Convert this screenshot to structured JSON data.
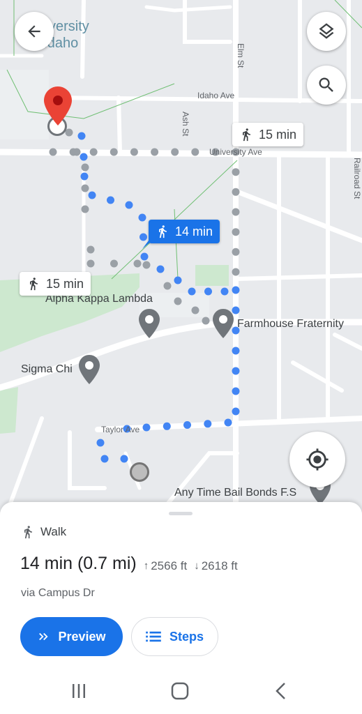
{
  "map": {
    "labels": {
      "university": "University\nof Idaho",
      "idaho_ave": "Idaho Ave",
      "ash_st": "Ash St",
      "elm_st": "Elm St",
      "university_ave": "University Ave",
      "railroad_st": "Railroad St",
      "taylor_ave": "Taylor Ave",
      "alpha_kappa_lambda": "Alpha Kappa Lambda",
      "farmhouse_fraternity": "Farmhouse Fraternity",
      "sigma_chi": "Sigma Chi",
      "bail_bonds": "Any Time Bail Bonds F.S"
    },
    "routes": [
      {
        "time": "15 min",
        "selected": false
      },
      {
        "time": "14 min",
        "selected": true
      },
      {
        "time": "15 min",
        "selected": false
      }
    ],
    "colors": {
      "route_active": "#4285f4",
      "route_alt": "#9aa0a6",
      "destination_pin": "#ea4335",
      "poi_pin": "#70757a",
      "park": "#c8e6c9",
      "walk_bubble": "#1a73e8"
    }
  },
  "controls": {
    "back": "arrow-back-icon",
    "layers": "layers-icon",
    "search": "search-icon",
    "my_location": "my-location-icon"
  },
  "sheet": {
    "mode": "Walk",
    "duration": "14 min (0.7 mi)",
    "ascent": "2566 ft",
    "descent": "2618 ft",
    "via": "via Campus Dr",
    "preview_label": "Preview",
    "steps_label": "Steps"
  }
}
